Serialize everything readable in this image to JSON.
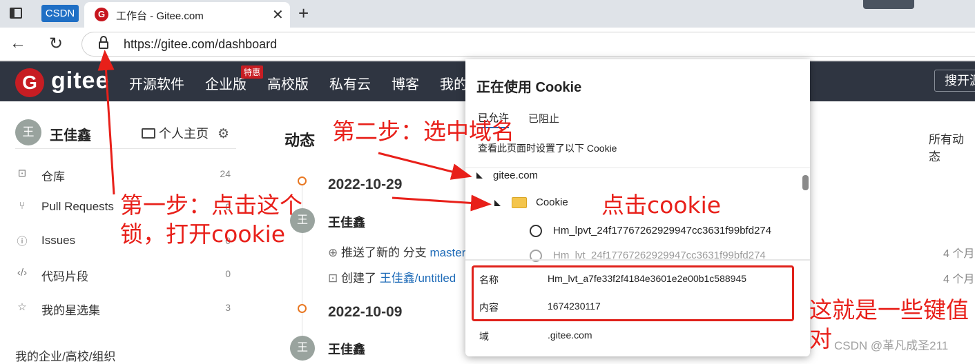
{
  "browser": {
    "pinned_tab": "CSDN",
    "active_tab": "工作台 - Gitee.com",
    "tab_favicon": "G",
    "url": "https://gitee.com/dashboard"
  },
  "gitee_nav": {
    "logo_letter": "G",
    "brand": "gitee",
    "items": [
      "开源软件",
      "企业版",
      "高校版",
      "私有云",
      "博客",
      "我的"
    ],
    "badge": "特惠",
    "search": "搜开源"
  },
  "sidebar": {
    "avatar": "王",
    "username": "王佳鑫",
    "homepage": "个人主页",
    "items": [
      {
        "label": "仓库",
        "count": "24",
        "icon": "repo-icon"
      },
      {
        "label": "Pull Requests",
        "count": "0",
        "icon": "pull-request-icon"
      },
      {
        "label": "Issues",
        "count": "0",
        "icon": "issue-icon"
      },
      {
        "label": "代码片段",
        "count": "0",
        "icon": "code-snippet-icon"
      },
      {
        "label": "我的星选集",
        "count": "3",
        "icon": "star-icon"
      }
    ],
    "orgs": "我的企业/高校/组织"
  },
  "feed": {
    "title": "动态",
    "filter": "所有动态",
    "groups": [
      {
        "date": "2022-10-29",
        "avatar": "王",
        "user": "王佳鑫",
        "activities": [
          {
            "text": "推送了新的 分支 ",
            "link": "master",
            "time": "4 个月"
          },
          {
            "text": "创建了 ",
            "link": "王佳鑫/untitled",
            "time": "4 个月"
          }
        ]
      },
      {
        "date": "2022-10-09",
        "avatar": "王",
        "user": "王佳鑫"
      }
    ]
  },
  "cookie_popup": {
    "title": "正在使用 Cookie",
    "tab_allowed": "已允许",
    "tab_blocked": "已阻止",
    "description": "查看此页面时设置了以下 Cookie",
    "domain": "gitee.com",
    "folder": "Cookie",
    "cookies": [
      "Hm_lpvt_24f17767262929947cc3631f99bfd274",
      "Hm_lvt_24f17767262929947cc3631f99bfd274"
    ],
    "details": {
      "name_label": "名称",
      "name_value": "Hm_lvt_a7fe33f2f4184e3601e2e00b1c588945",
      "content_label": "内容",
      "content_value": "1674230117",
      "domain_label": "域",
      "domain_value": ".gitee.com"
    }
  },
  "annotations": {
    "step1_line1": "第一步：点击这个",
    "step1_line2": "锁，打开cookie",
    "step2": "第二步：选中域名",
    "click_cookie": "点击cookie",
    "kv_line1": "这就是一些键值",
    "kv_line2": "对",
    "color": "#e8201a"
  },
  "watermark": "CSDN @革凡成圣211"
}
